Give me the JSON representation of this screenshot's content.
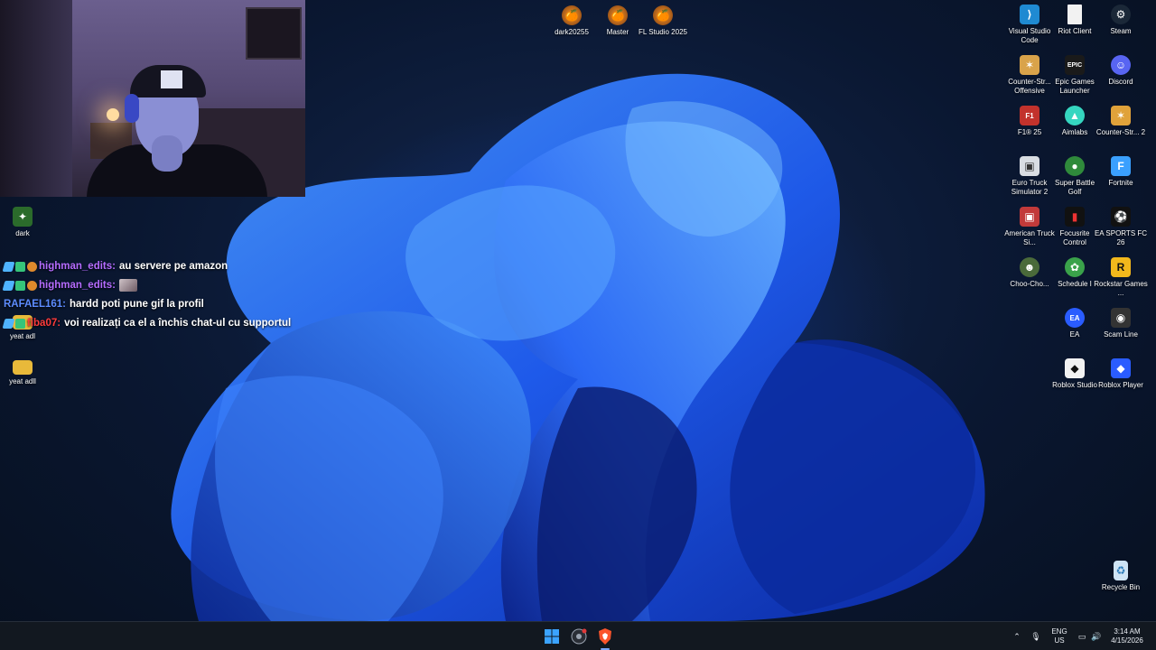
{
  "desktop": {
    "top_icons": [
      {
        "label": "dark20255",
        "icon": "fl-studio-icon"
      },
      {
        "label": "Master",
        "icon": "fl-studio-icon"
      },
      {
        "label": "FL Studio 2025",
        "icon": "fl-studio-icon"
      }
    ],
    "left_icons": [
      {
        "label": "dark",
        "icon": "game-icon"
      },
      {
        "label": "yeat adl",
        "icon": "folder-icon"
      },
      {
        "label": "yeat adll",
        "icon": "folder-icon"
      }
    ],
    "right_icons": [
      {
        "label": "Visual Studio Code",
        "icon": "vscode-icon"
      },
      {
        "label": "Riot Client",
        "icon": "file-icon"
      },
      {
        "label": "Steam",
        "icon": "steam-icon"
      },
      {
        "label": "Counter-Str... Offensive",
        "icon": "csgo-icon"
      },
      {
        "label": "Epic Games Launcher",
        "icon": "epic-icon"
      },
      {
        "label": "Discord",
        "icon": "discord-icon"
      },
      {
        "label": "F1® 25",
        "icon": "f1-icon"
      },
      {
        "label": "Aimlabs",
        "icon": "aimlabs-icon"
      },
      {
        "label": "Counter-Str... 2",
        "icon": "cs2-icon"
      },
      {
        "label": "Euro Truck Simulator 2",
        "icon": "truck-icon"
      },
      {
        "label": "Super Battle Golf",
        "icon": "golf-icon"
      },
      {
        "label": "Fortnite",
        "icon": "fortnite-icon"
      },
      {
        "label": "American Truck Si...",
        "icon": "truck-icon"
      },
      {
        "label": "Focusrite Control",
        "icon": "focusrite-icon"
      },
      {
        "label": "EA SPORTS FC 26",
        "icon": "fc-icon"
      },
      {
        "label": "Choo-Cho...",
        "icon": "choo-icon"
      },
      {
        "label": "Schedule I",
        "icon": "schedule-icon"
      },
      {
        "label": "Rockstar Games ...",
        "icon": "rockstar-icon"
      },
      {
        "label": "EA",
        "icon": "ea-icon"
      },
      {
        "label": "Scam Line",
        "icon": "scam-icon"
      },
      {
        "label": "Roblox Studio",
        "icon": "roblox-studio-icon"
      },
      {
        "label": "Roblox Player",
        "icon": "roblox-icon"
      },
      {
        "label": "Recycle Bin",
        "icon": "recycle-bin-icon"
      }
    ]
  },
  "chat": {
    "messages": [
      {
        "user": "highman_edits:",
        "text": "au servere pe amazon",
        "user_color": "#b56cff"
      },
      {
        "user": "highman_edits:",
        "text": "",
        "user_color": "#b56cff",
        "emote": "emote"
      },
      {
        "user": "RAFAEL161:",
        "text": "hardd poti pune gif la profil",
        "user_color": "#5d8cff"
      },
      {
        "user": "fiba07:",
        "text": "voi realizați ca el a închis chat-ul cu supportul",
        "user_color": "#ff3b3b"
      }
    ]
  },
  "taskbar": {
    "language": "ENG",
    "region": "US",
    "time": "3:14 AM",
    "date": "4/15/2026"
  },
  "colors": {
    "taskbar_bg": "#121820",
    "accent": "#2f6bff"
  }
}
